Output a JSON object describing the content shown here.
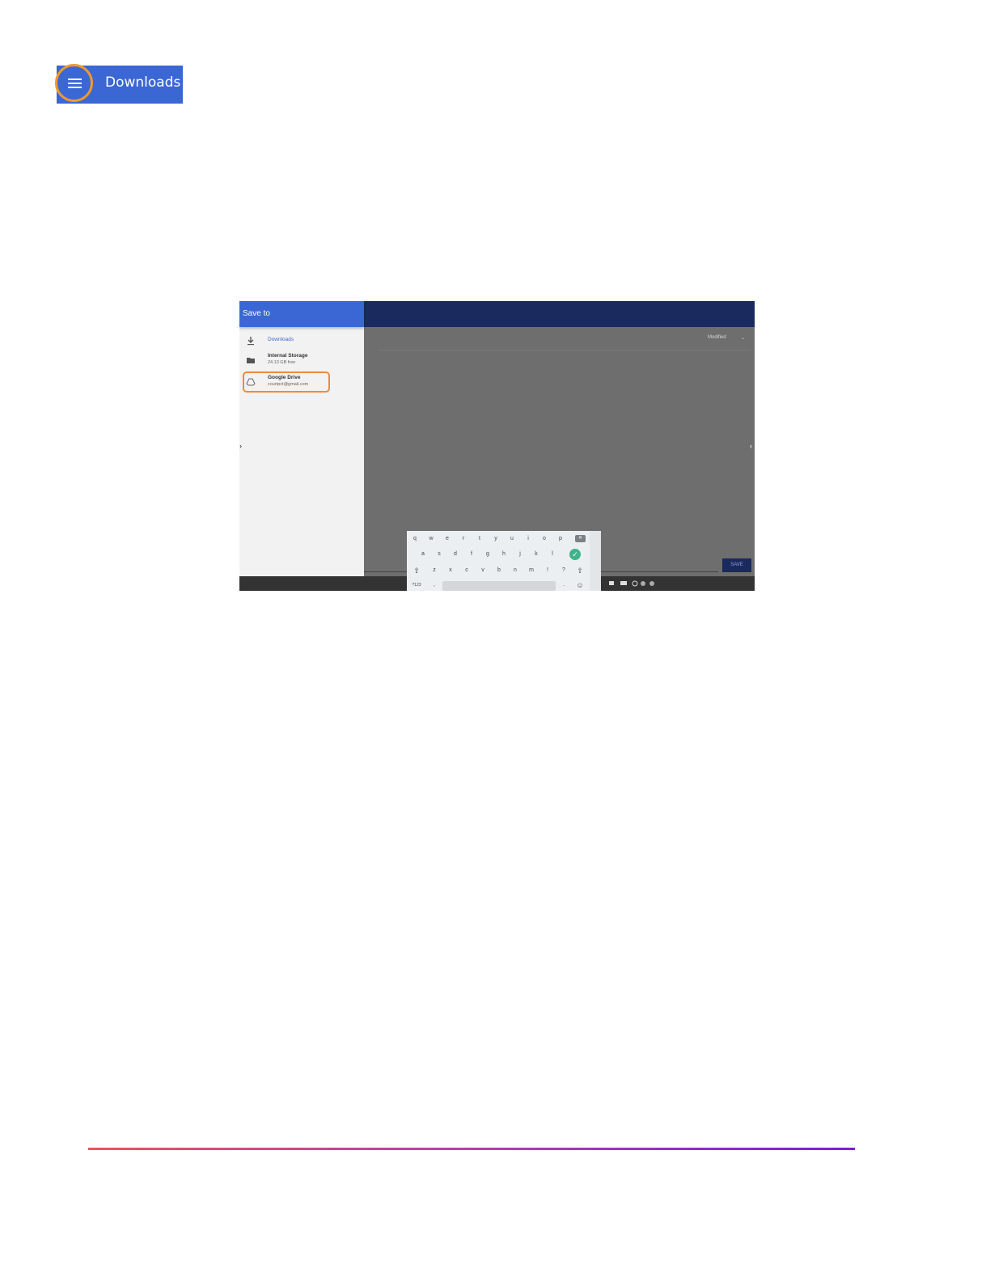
{
  "header": {
    "menu_icon": "hamburger-menu-icon",
    "title": "Downloads",
    "colors": {
      "bar": "#3a67d4",
      "highlight_ring": "#f0992d"
    }
  },
  "screenshot": {
    "drawer": {
      "title": "Save to",
      "items": [
        {
          "label": "Downloads",
          "sub": "",
          "icon": "download-icon"
        },
        {
          "label": "Internal Storage",
          "sub": "24.13 GB free",
          "icon": "folder-icon"
        },
        {
          "label": "Google Drive",
          "sub": "courtpct@gmail.com",
          "icon": "google-drive-icon"
        }
      ]
    },
    "sort_label": "Modified",
    "save_button": "SAVE",
    "keyboard": {
      "row1": [
        "q",
        "w",
        "e",
        "r",
        "t",
        "y",
        "u",
        "i",
        "o",
        "p"
      ],
      "row2": [
        "a",
        "s",
        "d",
        "f",
        "g",
        "h",
        "j",
        "k",
        "l"
      ],
      "row3": [
        "z",
        "x",
        "c",
        "v",
        "b",
        "n",
        "m",
        "!",
        "?"
      ],
      "row4_left": "?123",
      "row4_comma": ",",
      "row4_period": "."
    },
    "colors": {
      "highlight_box": "#ee8b3a",
      "topbar": "#1a2a5e",
      "check": "#3fb48c"
    }
  },
  "footer": {
    "rule_gradient": [
      "#e8545f",
      "#b33fae",
      "#7a1fd6"
    ]
  }
}
